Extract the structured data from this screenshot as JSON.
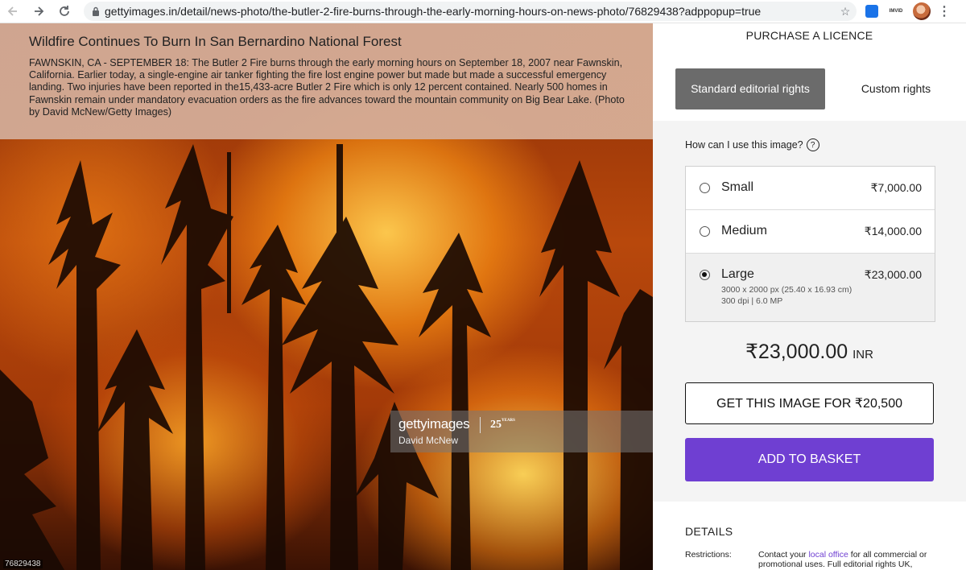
{
  "browser": {
    "url": "gettyimages.in/detail/news-photo/the-butler-2-fire-burns-through-the-early-morning-hours-on-news-photo/76829438?adppopup=true",
    "back_icon": "back-arrow-icon",
    "forward_icon": "forward-arrow-icon",
    "reload_icon": "reload-icon",
    "lock_icon": "lock-icon",
    "star_icon": "star-icon",
    "extension_label": "IMVID"
  },
  "caption": {
    "title": "Wildfire Continues To Burn In San Bernardino National Forest",
    "body": "FAWNSKIN, CA - SEPTEMBER 18: The Butler 2 Fire burns through the early morning hours on September 18, 2007 near Fawnskin, California. Earlier today, a single-engine air tanker fighting the fire lost engine power but made but made a successful emergency landing. Two injuries have been reported in the15,433-acre Butler 2 Fire which is only 12 percent contained. Nearly 500 homes in Fawnskin remain under mandatory evacuation orders as the fire advances toward the mountain community on Big Bear Lake. (Photo by David McNew/Getty Images)"
  },
  "watermark": {
    "logo": "gettyimages",
    "years": "25",
    "years_suffix": "YEARS",
    "credit": "David McNew"
  },
  "image_id": "76829438",
  "purchase": {
    "heading": "PURCHASE A LICENCE",
    "tab_standard": "Standard editorial rights",
    "tab_custom": "Custom rights",
    "question": "How can I use this image?",
    "help_icon": "?",
    "sizes": [
      {
        "name": "Small",
        "price": "₹7,000.00",
        "selected": false
      },
      {
        "name": "Medium",
        "price": "₹14,000.00",
        "selected": false
      },
      {
        "name": "Large",
        "price": "₹23,000.00",
        "selected": true,
        "dimensions": "3000 x 2000 px (25.40 x 16.93 cm)",
        "resolution": "300 dpi | 6.0 MP"
      }
    ],
    "total_amount": "₹23,000.00",
    "total_currency": "INR",
    "get_button": "GET THIS IMAGE FOR ₹20,500",
    "basket_button": "ADD TO BASKET",
    "accent_color": "#6f3fd2"
  },
  "details": {
    "title": "DETAILS",
    "restrictions_label": "Restrictions:",
    "restrictions_pre": "Contact your ",
    "restrictions_link": "local office",
    "restrictions_post": " for all commercial or promotional uses. Full editorial rights UK,"
  }
}
